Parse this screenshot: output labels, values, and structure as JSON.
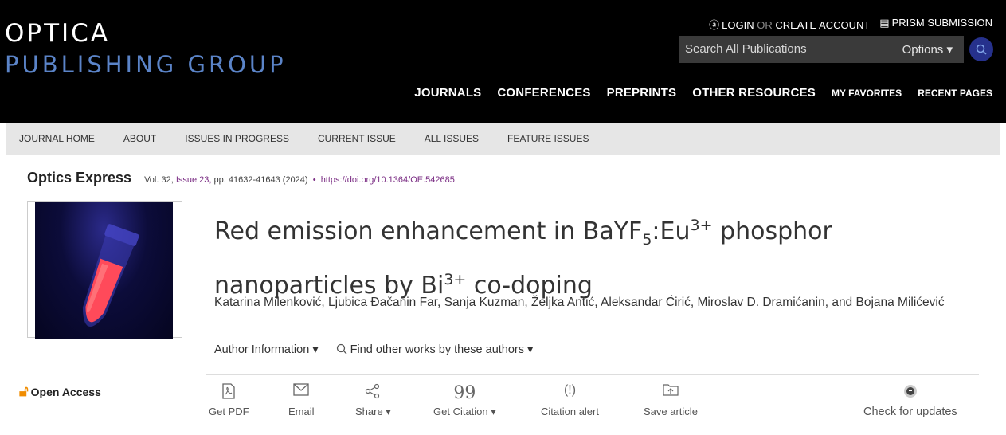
{
  "brand": {
    "line1": "OPTICA",
    "line2": "PUBLISHING GROUP"
  },
  "top_links": {
    "login": "LOGIN",
    "or": "OR",
    "create": "CREATE ACCOUNT",
    "prism": "PRISM SUBMISSION"
  },
  "search": {
    "placeholder": "Search All Publications",
    "options": "Options ▾"
  },
  "main_nav": [
    "JOURNALS",
    "CONFERENCES",
    "PREPRINTS",
    "OTHER RESOURCES",
    "MY FAVORITES",
    "RECENT PAGES"
  ],
  "sub_nav": [
    "JOURNAL HOME",
    "ABOUT",
    "ISSUES IN PROGRESS",
    "CURRENT ISSUE",
    "ALL ISSUES",
    "FEATURE ISSUES"
  ],
  "citation": {
    "journal": "Optics Express",
    "vol": "Vol. 32,",
    "issue": "Issue 23,",
    "pages": "pp. 41632-41643",
    "year": "(2024)",
    "dot": "•",
    "doi": "https://doi.org/10.1364/OE.542685"
  },
  "article": {
    "title_a": "Red emission enhancement in BaYF",
    "title_sub": "5",
    "title_b": ":Eu",
    "title_sup1": "3+",
    "title_c": " phosphor nanoparticles by Bi",
    "title_sup2": "3+",
    "title_d": " co-doping",
    "authors": "Katarina Milenković, Ljubica Đačanin Far, Sanja Kuzman, Željka Antić, Aleksandar Ćirić, Miroslav D. Dramićanin, and Bojana Milićević",
    "author_info": "Author Information ▾",
    "find_works": "Find other works by these authors ▾"
  },
  "open_access": "Open Access",
  "toolbar": {
    "pdf": "Get PDF",
    "email": "Email",
    "share": "Share ▾",
    "citation": "Get Citation ▾",
    "alert": "Citation alert",
    "save": "Save article",
    "updates": "Check for updates"
  },
  "colors": {
    "header_bg": "#000000",
    "logo_accent": "#5b84c8",
    "link": "#7a2c83",
    "search_btn": "#26318c",
    "open_access": "#f08c00"
  }
}
